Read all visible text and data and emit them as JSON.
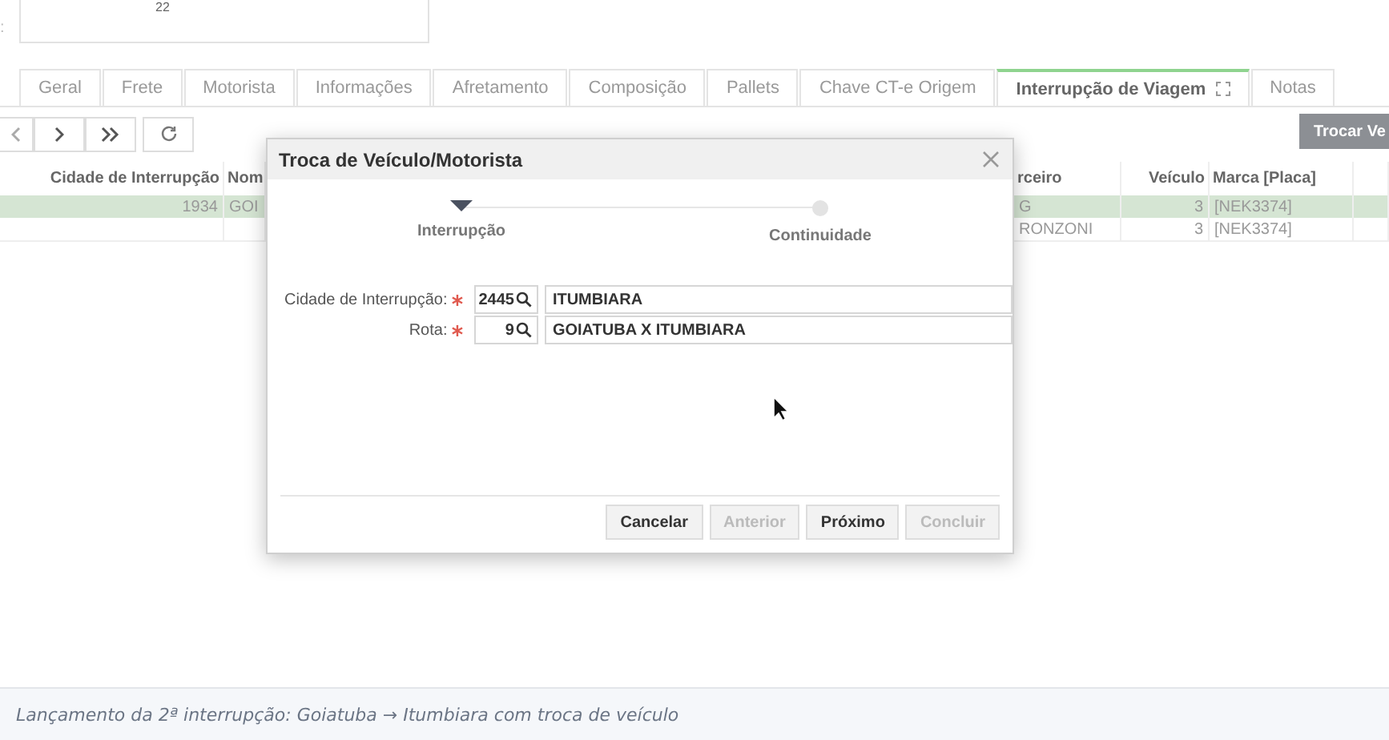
{
  "top_field": {
    "label": ":",
    "value": "22"
  },
  "tabs": [
    {
      "label": "Geral",
      "selected": false
    },
    {
      "label": "Frete",
      "selected": false
    },
    {
      "label": "Motorista",
      "selected": false
    },
    {
      "label": "Informações",
      "selected": false
    },
    {
      "label": "Afretamento",
      "selected": false
    },
    {
      "label": "Composição",
      "selected": false
    },
    {
      "label": "Pallets",
      "selected": false
    },
    {
      "label": "Chave CT-e Origem",
      "selected": false
    },
    {
      "label": "Interrupção de Viagem",
      "selected": true
    },
    {
      "label": "Notas",
      "selected": false
    }
  ],
  "toolbar": {
    "action_button": "Trocar Ve"
  },
  "table": {
    "columns": [
      "Cidade de Interrupção",
      "Nom",
      "rceiro",
      "Veículo",
      "Marca [Placa]"
    ],
    "rows": [
      {
        "selected": true,
        "cells": [
          "1934",
          "GOI",
          "G",
          "3",
          "[NEK3374]"
        ]
      },
      {
        "selected": false,
        "cells": [
          "",
          "",
          "RONZONI",
          "3",
          "[NEK3374]"
        ]
      }
    ]
  },
  "dialog": {
    "title": "Troca de Veículo/Motorista",
    "steps": [
      {
        "label": "Interrupção",
        "selected": true
      },
      {
        "label": "Continuidade",
        "selected": false
      }
    ],
    "fields": [
      {
        "label": "Cidade de Interrupção:",
        "required": true,
        "code": "2445",
        "value": "ITUMBIARA"
      },
      {
        "label": "Rota:",
        "required": true,
        "code": "9",
        "value": "GOIATUBA X ITUMBIARA"
      }
    ],
    "buttons": [
      {
        "label": "Cancelar",
        "disabled": false
      },
      {
        "label": "Anterior",
        "disabled": true
      },
      {
        "label": "Próximo",
        "disabled": false
      },
      {
        "label": "Concluir",
        "disabled": true
      }
    ]
  },
  "caption": "Lançamento da 2ª interrupção: Goiatuba → Itumbiara com troca de veículo"
}
